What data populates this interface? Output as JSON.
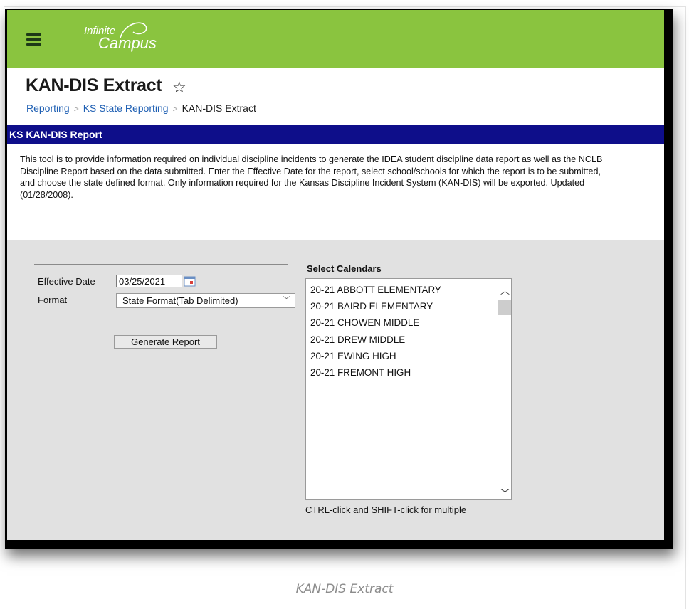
{
  "app": {
    "logo_line1": "Infinite",
    "logo_line2": "Campus",
    "brand_color": "#8ac43f"
  },
  "header": {
    "title": "KAN-DIS Extract",
    "breadcrumb": [
      "Reporting",
      "KS State Reporting",
      "KAN-DIS Extract"
    ]
  },
  "report": {
    "bar_title": "KS KAN-DIS Report",
    "bar_color": "#0e0e8a",
    "description": "This tool is to provide information required on individual discipline incidents to generate the IDEA student discipline data report as well as the NCLB Discipline Report based on the data submitted. Enter the Effective Date for the report, select school/schools for which the report is to be submitted, and choose the state defined format. Only information required for the Kansas Discipline Incident System (KAN-DIS) will be exported. Updated (01/28/2008)."
  },
  "form": {
    "effective_date_label": "Effective Date",
    "effective_date_value": "03/25/2021",
    "format_label": "Format",
    "format_selected": "State Format(Tab Delimited)",
    "generate_button": "Generate Report"
  },
  "calendars": {
    "heading": "Select Calendars",
    "items": [
      "20-21 ABBOTT ELEMENTARY",
      "20-21 BAIRD ELEMENTARY",
      "20-21 CHOWEN MIDDLE",
      "20-21 DREW MIDDLE",
      "20-21 EWING HIGH",
      "20-21 FREMONT HIGH"
    ],
    "hint": "CTRL-click and SHIFT-click for multiple"
  },
  "caption": "KAN-DIS Extract"
}
